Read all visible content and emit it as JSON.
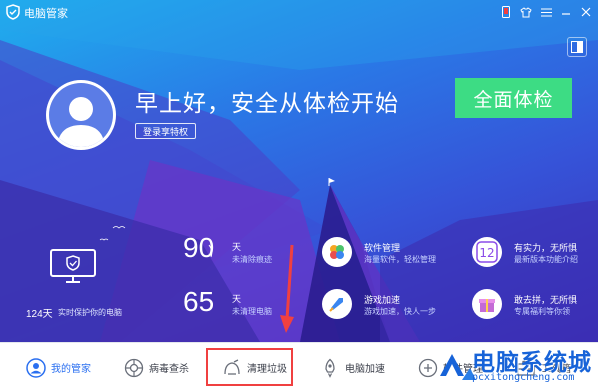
{
  "app": {
    "title": "电脑管家"
  },
  "titlebar": {
    "icons": [
      "phone-icon",
      "skin-icon",
      "menu-icon",
      "minimize-icon",
      "close-icon"
    ]
  },
  "hero": {
    "greeting": "早上好，安全从体检开始",
    "login_label": "登录享特权",
    "scan_label": "全面体检"
  },
  "stats": {
    "protect_days": "124天",
    "protect_label": "实时保护你的电脑",
    "trace": {
      "value": "90",
      "unit": "天",
      "desc": "未清除痕迹"
    },
    "garbage": {
      "value": "65",
      "unit": "天",
      "desc": "未清理电脑"
    }
  },
  "features": [
    {
      "title": "软件管理",
      "sub": "海量软件，轻松管理",
      "icon": "software-manager-icon"
    },
    {
      "title": "有实力，无所惧",
      "sub": "最新版本功能介绍",
      "icon": "version-12-icon"
    },
    {
      "title": "游戏加速",
      "sub": "游戏加速，快人一步",
      "icon": "game-boost-icon"
    },
    {
      "title": "敢去拼，无所惧",
      "sub": "专属福利等你领",
      "icon": "gift-icon"
    }
  ],
  "nav": [
    {
      "label": "我的管家",
      "icon": "my-manager-icon",
      "active": true
    },
    {
      "label": "病毒查杀",
      "icon": "virus-scan-icon",
      "active": false
    },
    {
      "label": "清理垃圾",
      "icon": "cleanup-icon",
      "active": false
    },
    {
      "label": "电脑加速",
      "icon": "speedup-icon",
      "active": false
    },
    {
      "label": "软件管理",
      "icon": "software-icon",
      "active": false
    },
    {
      "label": "工具箱",
      "icon": "toolbox-icon",
      "active": false
    }
  ],
  "watermark": {
    "title": "电脑系统城",
    "sub": "pcxitongcheng.com"
  },
  "colors": {
    "accent_green": "#3ddc84",
    "highlight_red": "#f04040",
    "nav_active": "#2a6ff0"
  }
}
